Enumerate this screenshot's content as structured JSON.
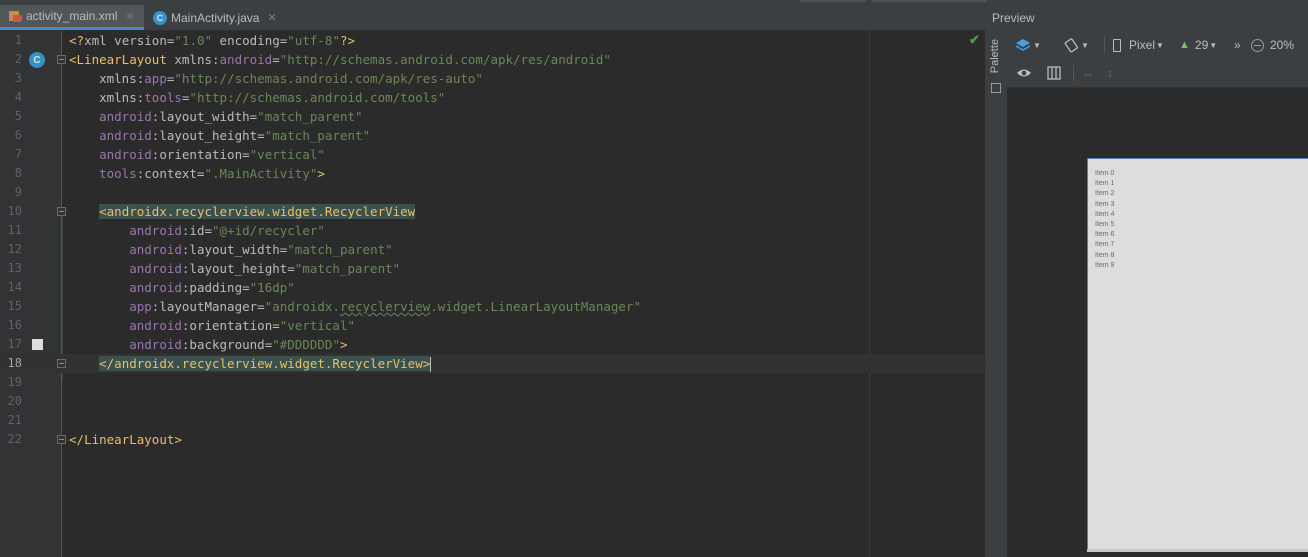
{
  "tabs": [
    {
      "label": "activity_main.xml",
      "active": true,
      "icon": "xml-file-icon"
    },
    {
      "label": "MainActivity.java",
      "active": false,
      "icon": "java-class-icon"
    }
  ],
  "editor": {
    "current_line": 18,
    "line_numbers": [
      "1",
      "2",
      "3",
      "4",
      "5",
      "6",
      "7",
      "8",
      "9",
      "10",
      "11",
      "12",
      "13",
      "14",
      "15",
      "16",
      "17",
      "18",
      "19",
      "20",
      "21",
      "22"
    ],
    "inspection_status": "no-problems-check-icon",
    "code": {
      "l1": {
        "a": "<?",
        "b": "xml version",
        "c": "=",
        "d": "\"1.0\"",
        "e": " encoding",
        "f": "=",
        "g": "\"utf-8\"",
        "h": "?>"
      },
      "l2": {
        "a": "<",
        "b": "LinearLayout",
        "c": " xmlns:",
        "d": "android",
        "e": "=",
        "f": "\"http://schemas.android.com/apk/res/android\""
      },
      "l3": {
        "a": "xmlns:",
        "b": "app",
        "c": "=",
        "d": "\"http://schemas.android.com/apk/res-auto\""
      },
      "l4": {
        "a": "xmlns:",
        "b": "tools",
        "c": "=",
        "d": "\"http://schemas.android.com/tools\""
      },
      "l5": {
        "ns": "android",
        "attr": ":layout_width",
        "eq": "=",
        "val": "\"match_parent\""
      },
      "l6": {
        "ns": "android",
        "attr": ":layout_height",
        "eq": "=",
        "val": "\"match_parent\""
      },
      "l7": {
        "ns": "android",
        "attr": ":orientation",
        "eq": "=",
        "val": "\"vertical\""
      },
      "l8": {
        "ns": "tools",
        "attr": ":context",
        "eq": "=",
        "val": "\".MainActivity\"",
        "end": ">"
      },
      "l10": {
        "a": "<",
        "b": "androidx.recyclerview.widget.RecyclerView"
      },
      "l11": {
        "ns": "android",
        "attr": ":id",
        "eq": "=",
        "val": "\"@+id/recycler\""
      },
      "l12": {
        "ns": "android",
        "attr": ":layout_width",
        "eq": "=",
        "val": "\"match_parent\""
      },
      "l13": {
        "ns": "android",
        "attr": ":layout_height",
        "eq": "=",
        "val": "\"match_parent\""
      },
      "l14": {
        "ns": "android",
        "attr": ":padding",
        "eq": "=",
        "val": "\"16dp\""
      },
      "l15": {
        "ns": "app",
        "attr": ":layoutManager",
        "eq": "=",
        "v1": "\"androidx.",
        "v2": "recyclerview",
        "v3": ".widget.LinearLayoutManager\""
      },
      "l16": {
        "ns": "android",
        "attr": ":orientation",
        "eq": "=",
        "val": "\"vertical\""
      },
      "l17": {
        "ns": "android",
        "attr": ":background",
        "eq": "=",
        "val": "\"#DDDDDD\"",
        "end": ">"
      },
      "l18": {
        "a": "</",
        "b": "androidx.recyclerview.widget.RecyclerView",
        "c": ">"
      },
      "l22": {
        "a": "</",
        "b": "LinearLayout",
        "c": ">"
      }
    },
    "background_swatch_color": "#DDDDDD"
  },
  "preview": {
    "title": "Preview",
    "palette_label": "Palette",
    "toolbar": {
      "device": "Pixel",
      "api": "29",
      "more": "»",
      "zoom": "20%"
    },
    "recycler_items": [
      "Item 0",
      "Item 1",
      "Item 2",
      "Item 3",
      "Item 4",
      "Item 5",
      "Item 6",
      "Item 7",
      "Item 8",
      "Item 9"
    ]
  }
}
